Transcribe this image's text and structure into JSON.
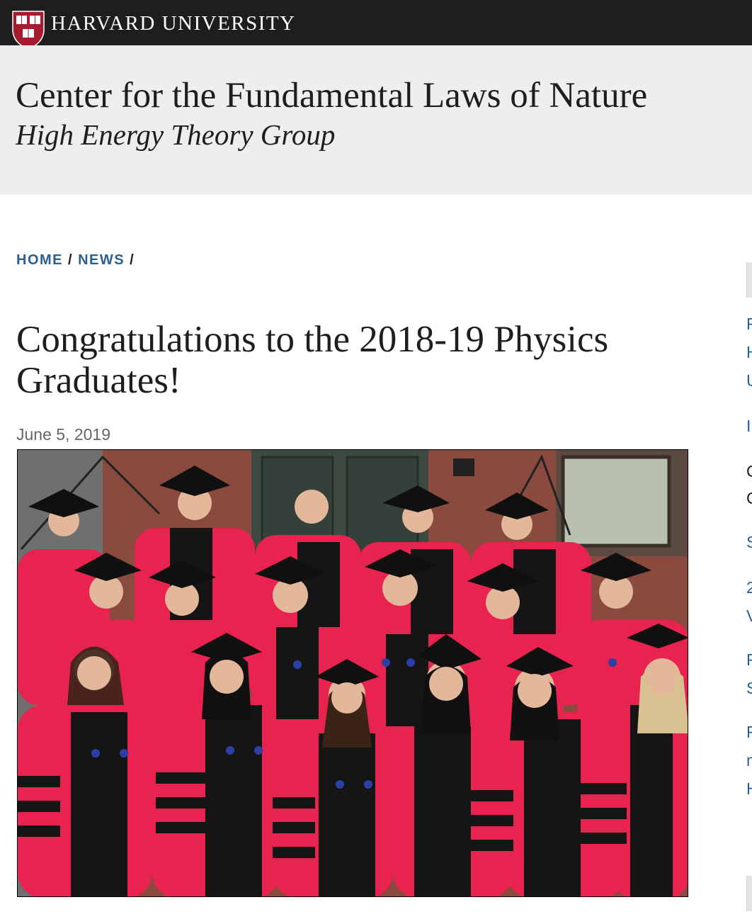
{
  "harvard_bar": {
    "title": "HARVARD UNIVERSITY",
    "bg": "#1e1e1e",
    "shield_color": "#a51c30"
  },
  "site": {
    "title": "Center for the Fundamental Laws of Nature",
    "subtitle": "High Energy Theory Group",
    "header_bg": "#eeeeee"
  },
  "breadcrumb": {
    "items": [
      "HOME",
      "NEWS"
    ],
    "separator": "/",
    "link_color": "#2b5f8e"
  },
  "article": {
    "title": "Congratulations to the 2018-19 Physics Graduates!",
    "date": "June 5, 2019",
    "photo": {
      "icon": "group-photo",
      "gown_color": "#e8234f",
      "stripe_color": "#111111"
    }
  },
  "sidebar": {
    "lines": [
      {
        "text": "F",
        "style": "link"
      },
      {
        "text": "H",
        "style": "link"
      },
      {
        "text": "U",
        "style": "link"
      },
      {
        "text": "I",
        "style": "link"
      },
      {
        "text": "C",
        "style": "text"
      },
      {
        "text": "C",
        "style": "text"
      },
      {
        "text": "S",
        "style": "link"
      },
      {
        "text": "2",
        "style": "link"
      },
      {
        "text": "V",
        "style": "link"
      },
      {
        "text": "F",
        "style": "link"
      },
      {
        "text": "S",
        "style": "link"
      },
      {
        "text": "F",
        "style": "link"
      },
      {
        "text": "n",
        "style": "link"
      },
      {
        "text": "H",
        "style": "link"
      }
    ]
  }
}
